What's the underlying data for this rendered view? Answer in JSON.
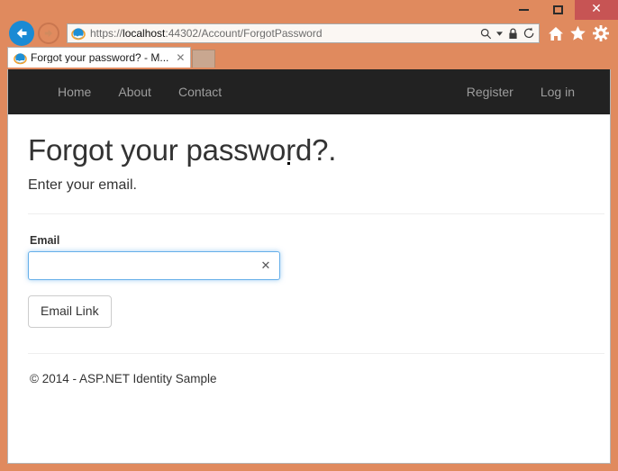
{
  "browser": {
    "window_controls": {
      "minimize_label": "–",
      "maximize_label": "□",
      "close_label": "✕"
    },
    "back_icon": "back-arrow-icon",
    "forward_icon": "forward-arrow-icon",
    "address": {
      "scheme": "https://",
      "host": "localhost",
      "rest": ":44302/Account/ForgotPassword",
      "full_url": "https://localhost:44302/Account/ForgotPassword",
      "search_icon": "search-icon",
      "caret_icon": "chevron-down-icon",
      "lock_icon": "lock-icon",
      "refresh_icon": "refresh-icon"
    },
    "toolbar": {
      "home_icon": "home-icon",
      "favorites_icon": "star-icon",
      "settings_icon": "gear-icon"
    },
    "tab": {
      "favicon": "internet-explorer-icon",
      "title": "Forgot your password? - M...",
      "close_label": "✕"
    },
    "new_tab_label": ""
  },
  "page": {
    "navbar": {
      "left_links": [
        {
          "label": "Home"
        },
        {
          "label": "About"
        },
        {
          "label": "Contact"
        }
      ],
      "right_links": [
        {
          "label": "Register"
        },
        {
          "label": "Log in"
        }
      ]
    },
    "heading": "Forgot your password?.",
    "subheading": "Enter your email.",
    "form": {
      "email_label": "Email",
      "email_value": "",
      "email_placeholder": "",
      "clear_icon_label": "✕",
      "submit_label": "Email Link"
    },
    "footer": "© 2014 - ASP.NET Identity Sample"
  },
  "colors": {
    "window_frame": "#e08a5e",
    "navbar_bg": "#222222",
    "navbar_link": "#9d9d9d",
    "close_button": "#c75454",
    "focus_border": "#66afe9",
    "back_button": "#1a8ad4"
  }
}
